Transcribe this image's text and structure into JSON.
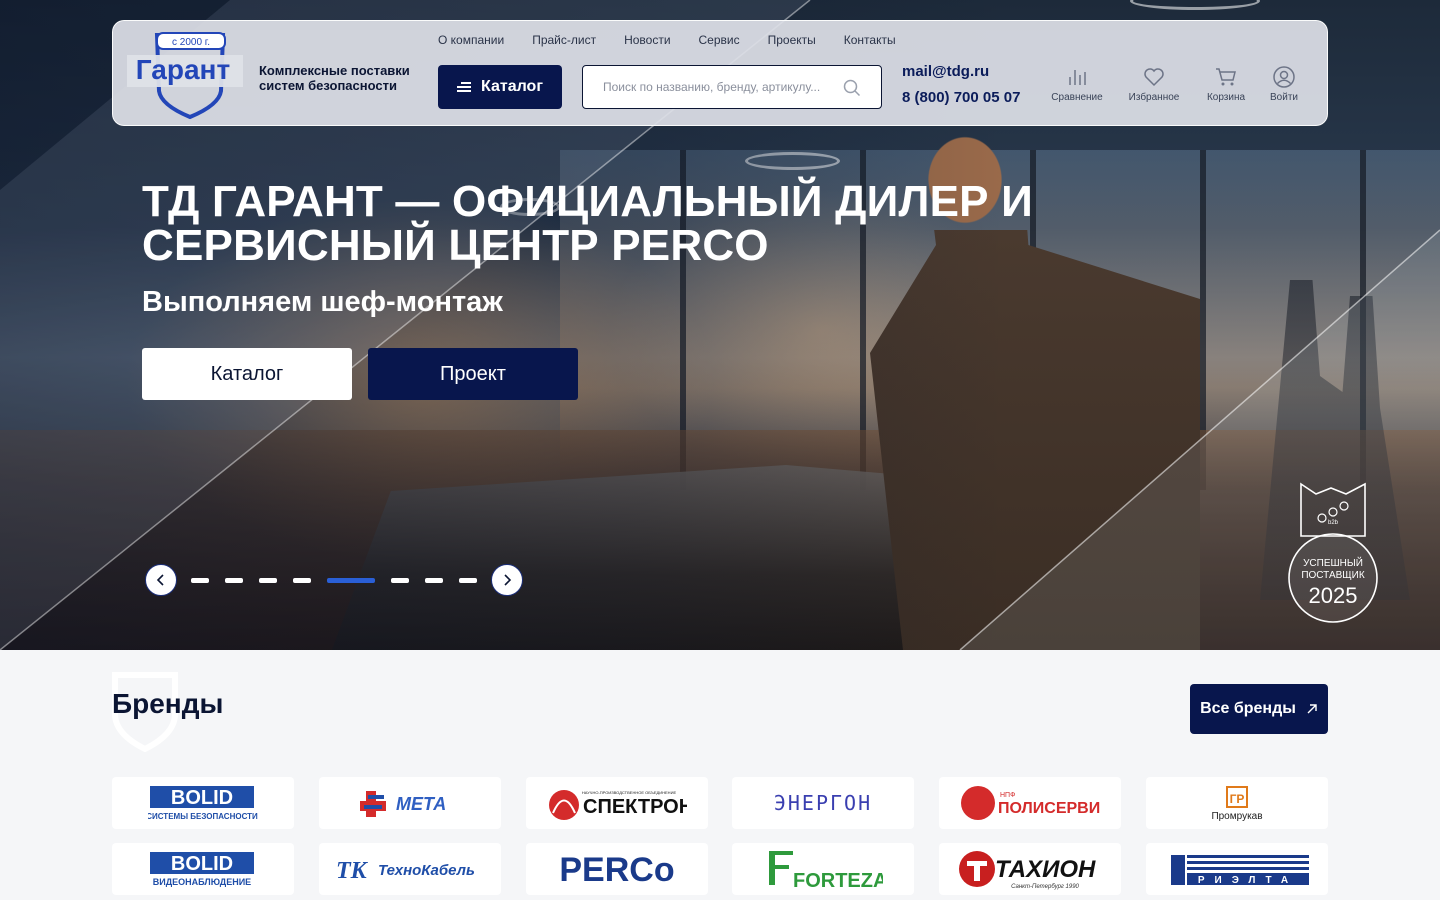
{
  "header": {
    "logo": {
      "since": "с 2000 г.",
      "name": "Гарант"
    },
    "tagline": "Комплексные поставки систем безопасности",
    "nav": [
      "О компании",
      "Прайс-лист",
      "Новости",
      "Сервис",
      "Проекты",
      "Контакты"
    ],
    "catalog_label": "Каталог",
    "search_placeholder": "Поиск по названию, бренду, артикулу...",
    "email": "mail@tdg.ru",
    "phone": "8 (800) 700 05 07",
    "icons": [
      {
        "icon": "compare-icon",
        "label": "Сравнение"
      },
      {
        "icon": "heart-icon",
        "label": "Избранное"
      },
      {
        "icon": "cart-icon",
        "label": "Корзина"
      },
      {
        "icon": "user-icon",
        "label": "Войти"
      }
    ]
  },
  "hero": {
    "title": "ТД ГАРАНТ — ОФИЦИАЛЬНЫЙ ДИЛЕР И СЕРВИСНЫЙ ЦЕНТР PERCO",
    "subtitle": "Выполняем шеф-монтаж",
    "btn_catalog": "Каталог",
    "btn_project": "Проект",
    "slides_total": 8,
    "active_slide": 5,
    "badge": {
      "line1": "УСПЕШНЫЙ",
      "line2": "ПОСТАВЩИК",
      "year": "2025",
      "tag": "b2b"
    }
  },
  "brands": {
    "title": "Бренды",
    "all_label": "Все бренды",
    "items": [
      {
        "name": "BOLID",
        "sub": "СИСТЕМЫ БЕЗОПАСНОСТИ"
      },
      {
        "name": "МЕТА"
      },
      {
        "name": "СПЕКТРОН",
        "sub": "НАУЧНО-ПРОИЗВОДСТВЕННОЕ ОБЪЕДИНЕНИЕ"
      },
      {
        "name": "ЭНЕРГОН"
      },
      {
        "name": "ПОЛИСЕРВИС",
        "sub": "НПФ"
      },
      {
        "name": "Промрукав"
      },
      {
        "name": "BOLID",
        "sub": "ВИДЕОНАБЛЮДЕНИЕ"
      },
      {
        "name": "ТехноКабель"
      },
      {
        "name": "PERCo"
      },
      {
        "name": "FORTEZA"
      },
      {
        "name": "ТАХИОН",
        "sub": "Санкт-Петербург 1990"
      },
      {
        "name": "РИЭЛТА"
      }
    ]
  },
  "colors": {
    "primary": "#08164d",
    "accent": "#2a5fd6",
    "logo_blue": "#2346b8"
  }
}
